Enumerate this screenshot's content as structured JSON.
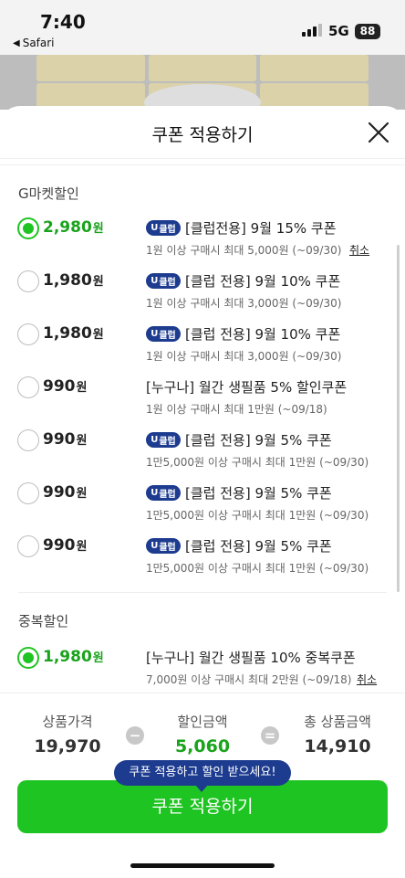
{
  "status_bar": {
    "time": "7:40",
    "back_app": "Safari",
    "network": "5G",
    "battery": "88"
  },
  "sheet": {
    "title": "쿠폰 적용하기"
  },
  "sections": {
    "gmarket": "G마켓할인",
    "overlap": "중복할인"
  },
  "coupons": [
    {
      "amount": "2,980",
      "unit": "원",
      "badge": true,
      "name": "[클럽전용] 9월 15% 쿠폰",
      "desc": "1원 이상 구매시 최대 5,000원 (~09/30)",
      "cancel": "취소",
      "selected": true
    },
    {
      "amount": "1,980",
      "unit": "원",
      "badge": true,
      "name": "[클럽 전용] 9월 10% 쿠폰",
      "desc": "1원 이상 구매시 최대 3,000원 (~09/30)",
      "selected": false
    },
    {
      "amount": "1,980",
      "unit": "원",
      "badge": true,
      "name": "[클럽 전용] 9월 10% 쿠폰",
      "desc": "1원 이상 구매시 최대 3,000원 (~09/30)",
      "selected": false
    },
    {
      "amount": "990",
      "unit": "원",
      "badge": false,
      "name": "[누구나] 월간 생필품 5% 할인쿠폰",
      "desc": "1원 이상 구매시 최대 1만원 (~09/18)",
      "selected": false
    },
    {
      "amount": "990",
      "unit": "원",
      "badge": true,
      "name": "[클럽 전용] 9월 5% 쿠폰",
      "desc": "1만5,000원 이상 구매시 최대 1만원 (~09/30)",
      "selected": false
    },
    {
      "amount": "990",
      "unit": "원",
      "badge": true,
      "name": "[클럽 전용] 9월 5% 쿠폰",
      "desc": "1만5,000원 이상 구매시 최대 1만원 (~09/30)",
      "selected": false
    },
    {
      "amount": "990",
      "unit": "원",
      "badge": true,
      "name": "[클럽 전용] 9월 5% 쿠폰",
      "desc": "1만5,000원 이상 구매시 최대 1만원 (~09/30)",
      "selected": false
    }
  ],
  "overlap_coupon": {
    "amount": "1,980",
    "unit": "원",
    "name": "[누구나] 월간 생필품 10% 중복쿠폰",
    "desc": "7,000원 이상 구매시 최대 2만원 (~09/18)",
    "cancel": "취소",
    "selected": true
  },
  "badge_label": {
    "u": "U",
    "text": "클럽"
  },
  "summary": {
    "price_label": "상품가격",
    "price": "19,970",
    "minus": "−",
    "discount_label": "할인금액",
    "discount": "5,060",
    "equals": "=",
    "total_label": "총 상품금액",
    "total": "14,910"
  },
  "tooltip": "쿠폰 적용하고 할인 받으세요!",
  "apply_button": "쿠폰 적용하기",
  "colors": {
    "green": "#1ec421",
    "navy": "#1d3c8f"
  }
}
